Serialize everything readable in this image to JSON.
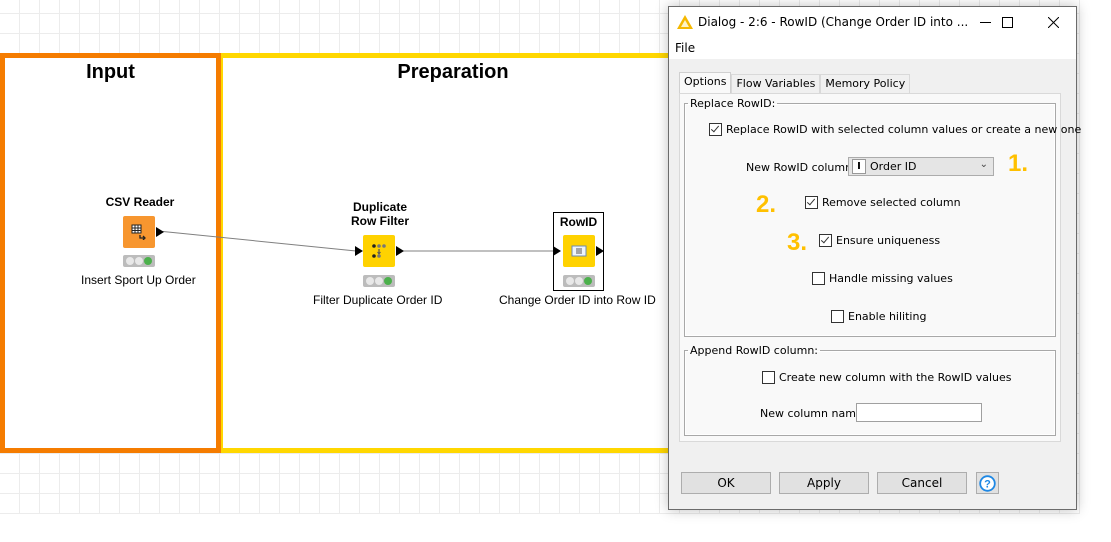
{
  "workflow": {
    "annotations": [
      {
        "title": "Input",
        "color": "#f57c00"
      },
      {
        "title": "Preparation",
        "color": "#ffd700"
      }
    ],
    "nodes": [
      {
        "title": "CSV Reader",
        "label": "Insert Sport Up Order",
        "icon": "table-arrow-icon",
        "color": "#f7962f",
        "status": "executed"
      },
      {
        "title": "Duplicate Row Filter",
        "title_line1": "Duplicate",
        "title_line2": "Row Filter",
        "label": "Filter Duplicate Order ID",
        "icon": "dots-filter-icon",
        "color": "#ffd200",
        "status": "executed"
      },
      {
        "title": "RowID",
        "label": "Change Order ID into Row ID",
        "icon": "rowid-icon",
        "color": "#ffd200",
        "status": "executed",
        "selected": true
      }
    ]
  },
  "dialog": {
    "title": "Dialog - 2:6 - RowID (Change Order ID into ...",
    "menu": [
      "File"
    ],
    "tabs": [
      {
        "label": "Options",
        "active": true
      },
      {
        "label": "Flow Variables",
        "active": false
      },
      {
        "label": "Memory Policy",
        "active": false
      }
    ],
    "replace_group": {
      "legend": "Replace RowID:",
      "replace_checkbox": {
        "label": "Replace RowID with selected column values or create a new one",
        "checked": true
      },
      "new_rowid_column_label": "New RowID column:",
      "new_rowid_column_value": "Order ID",
      "new_rowid_column_type_icon": "I",
      "remove_selected": {
        "label": "Remove selected column",
        "checked": true
      },
      "ensure_uniqueness": {
        "label": "Ensure uniqueness",
        "checked": true
      },
      "handle_missing": {
        "label": "Handle missing values",
        "checked": false
      },
      "enable_hiliting": {
        "label": "Enable hiliting",
        "checked": false
      }
    },
    "append_group": {
      "legend": "Append RowID column:",
      "create_column": {
        "label": "Create new column with the RowID values",
        "checked": false
      },
      "new_column_name_label": "New column name:",
      "new_column_name_value": ""
    },
    "buttons": {
      "ok": "OK",
      "apply": "Apply",
      "cancel": "Cancel",
      "help": "?"
    }
  },
  "step_markers": [
    "1.",
    "2.",
    "3."
  ],
  "colors": {
    "marker": "#ffc000",
    "input_border": "#f57c00",
    "prep_border": "#ffd700"
  }
}
